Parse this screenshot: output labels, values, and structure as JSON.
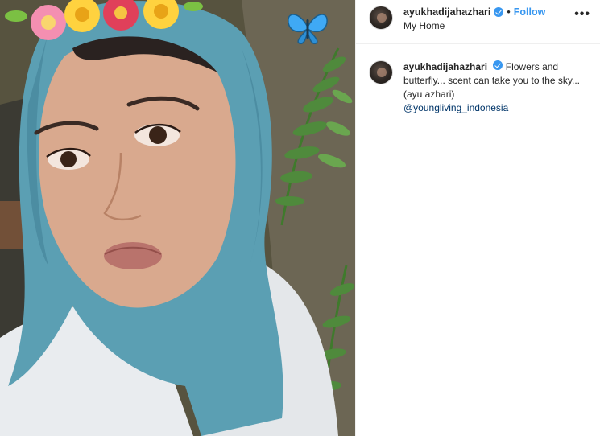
{
  "post": {
    "username": "ayukhadijahazhari",
    "separator": "•",
    "follow_label": "Follow",
    "location": "My Home",
    "more_label": "•••",
    "verified_icon": "verified-badge-icon",
    "accent_color": "#3897f0"
  },
  "caption": {
    "username": "ayukhadijahazhari",
    "text": "Flowers and butterfly... scent can take you to the sky... (ayu azhari)",
    "mention": "@youngliving_indonesia"
  },
  "photo": {
    "overlay_icons": [
      "flower-crown-icon",
      "butterfly-icon",
      "fern-leaves"
    ]
  }
}
